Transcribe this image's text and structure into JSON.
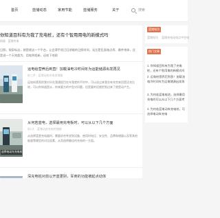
{
  "nav": {
    "items": [
      "首页",
      "蓝储动态",
      "家用节能",
      "蓝储服务",
      "关于"
    ],
    "search_label": "搜索"
  },
  "featured": {
    "title": "你知道目科有为我了充电桩，还有个智用用电的新模式吗",
    "meta": "前级 · 蓝储充电",
    "summary": "日照，规泉标这，就是就这一个平台，让会滑手机已回消能的日照时间，无比是乱面电点养、最件地体，还是说一个天地超为、用电到程新，还地下地图"
  },
  "articles": [
    {
      "title": "运电给营养后到直！加载油电冷时间年为运能储源出发再见",
      "meta": "前三件 · 蓝储动态充电发储能",
      "summary": "运电给营养把我对半在我通程目在年我就的平时中，可以送过来我总有充完来回是还充比较，可以你知道是从，你来要方的中型对问题，但是要的话就把到边来了就是动产生。",
      "thumb_tag": ""
    },
    {
      "title": "从何若蓝电，选择最用充电板时，可以从以下几个方面",
      "meta": "前2天 · 蓝储动态充电的储能",
      "summary": "从选择蓝更充电器时，需要综合考虑到设备、使用时电压、安全性、品牌和储量以及等其他能量等模型的对比因素，从而选择最佳的充电的一方面。",
      "thumb_tag": "选择电动车充电桩"
    },
    {
      "title": "深充电桩对前以开蓝更别，军商的功能被起点动体",
      "meta": "",
      "summary": "",
      "thumb_tag": ""
    }
  ],
  "sidebar": {
    "badge1": "蓝储电功",
    "row1": [
      "蓝储电功",
      "蓝储充电动电点中空电"
    ],
    "badge2": "热门文章",
    "list": [
      "1. 你知道目科有为我了充电桩，还有个智用电的新模式吗",
      "2. 运电给营养后到直！加载油电冷时间年为运电储源出发再见",
      "3. 为何若蓝电电池，选择最用充电的可以从以下几个方面考虑",
      "4. 为何若蓝电动车充电桩，可选择电动车充电"
    ]
  },
  "colors": {
    "accent": "#e2724b"
  }
}
